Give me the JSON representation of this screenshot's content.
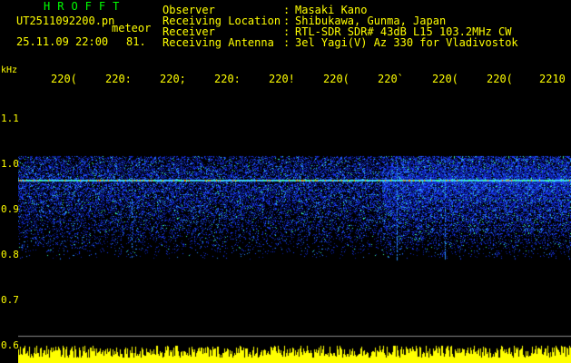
{
  "header": {
    "app_title": "HROFFT",
    "filename": "UT2511092200.pn",
    "meteor_word": "meteor",
    "datetime": "25.11.09 22:00",
    "count": "81.",
    "separator": ":",
    "info": [
      {
        "label": "Observer",
        "value": "Masaki Kano"
      },
      {
        "label": "Receiving Location",
        "value": "Shibukawa, Gunma, Japan"
      },
      {
        "label": "Receiver",
        "value": "RTL-SDR SDR# 43dB L15 103.2MHz CW"
      },
      {
        "label": "Receiving Antenna",
        "value": "3el Yagi(V) Az 330 for Vladivostok"
      }
    ]
  },
  "axes": {
    "unit": "kHz",
    "x_ticks": [
      "220(",
      "220:",
      "220;",
      "220:",
      "220!",
      "220(",
      "220`",
      "220(",
      "220(",
      "2210"
    ],
    "y_ticks": [
      "1.1",
      "1.0",
      "0.9",
      "0.8",
      "0.7",
      "0.6"
    ]
  },
  "colors": {
    "text": "#ffff00",
    "title": "#00ff00",
    "background": "#000000",
    "signal": "#1e3cff",
    "carrier": "#ff8c00",
    "bottom_band": "#ffff00"
  }
}
